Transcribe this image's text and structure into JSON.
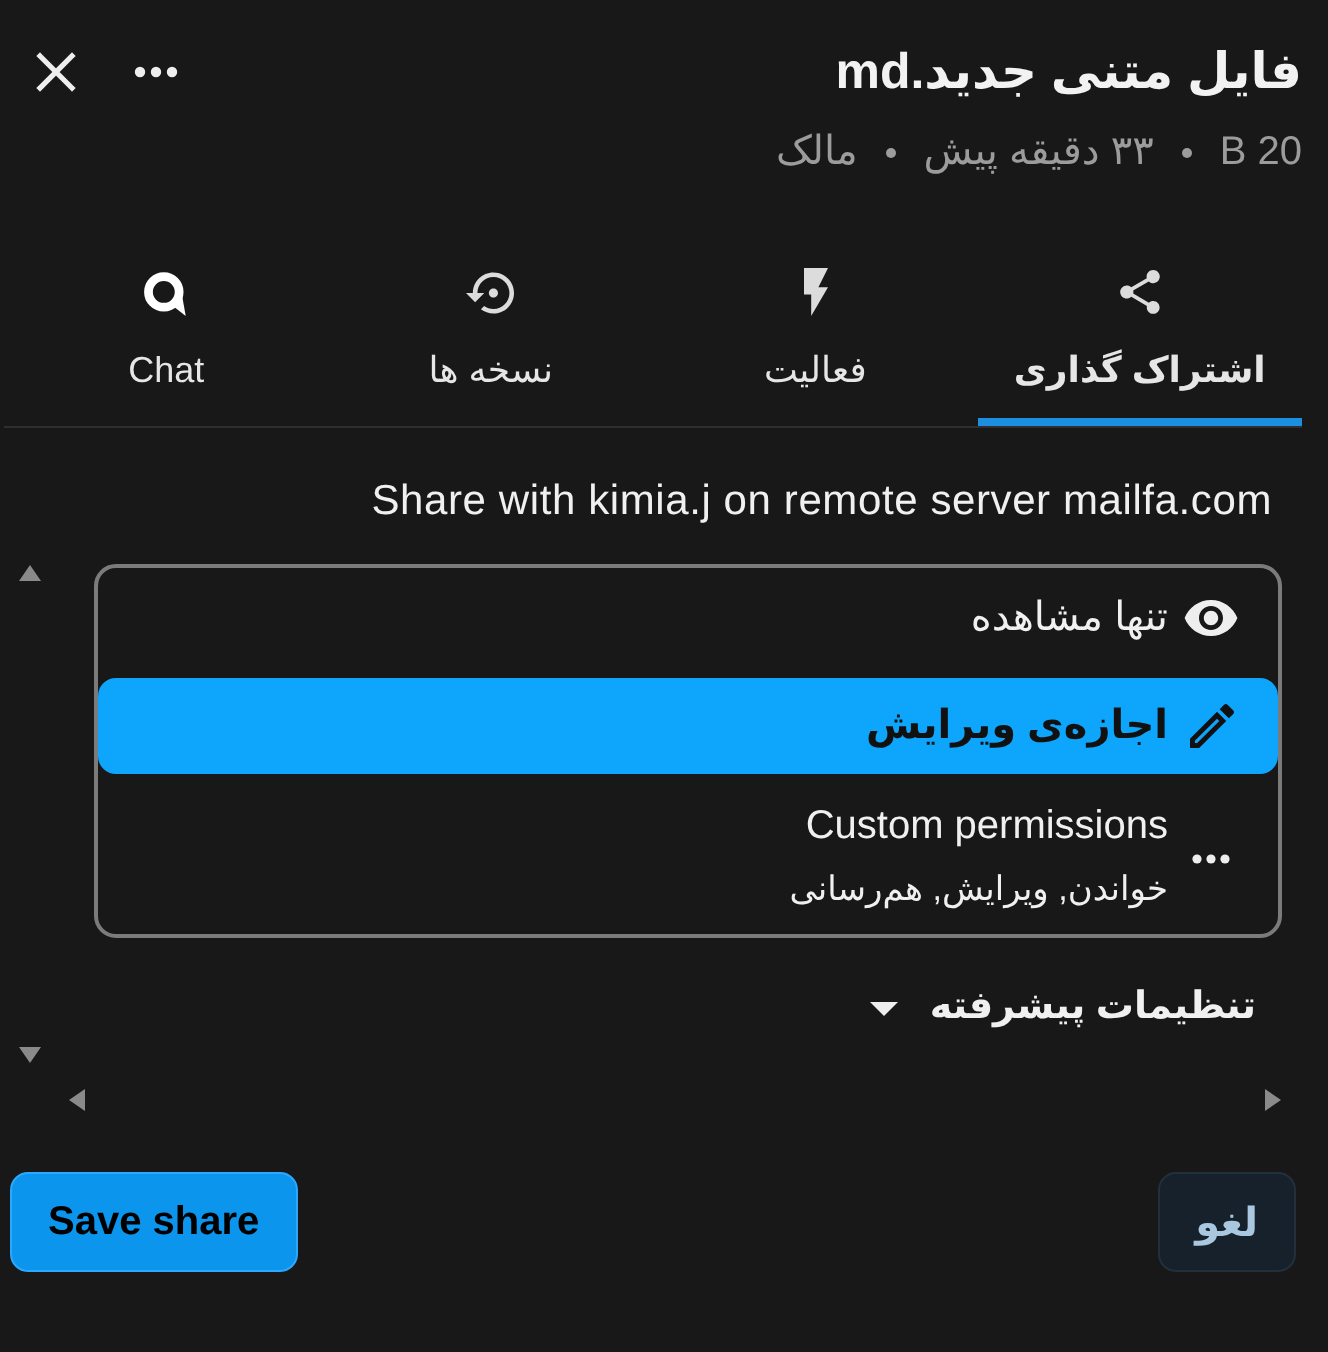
{
  "header": {
    "title": "فایل متنی جدید.md",
    "meta": [
      "20 B",
      "۳۳ دقیقه پیش",
      "مالک"
    ]
  },
  "tabs": [
    {
      "label": "اشتراک گذاری",
      "kind": "share",
      "selected": true
    },
    {
      "label": "فعالیت",
      "kind": "activity",
      "selected": false
    },
    {
      "label": "نسخه ها",
      "kind": "versions",
      "selected": false
    },
    {
      "label": "Chat",
      "kind": "chat",
      "selected": false
    }
  ],
  "share": {
    "recipient_line": "Share with kimia.j on remote server mailfa.com",
    "permissions": [
      {
        "kind": "view",
        "label": "تنها مشاهده",
        "selected": false
      },
      {
        "kind": "edit",
        "label": "اجازه‌ی ویرایش",
        "selected": true
      },
      {
        "kind": "custom",
        "label": "Custom permissions",
        "description": "خواندن, ویرایش, هم‌رسانی",
        "selected": false
      }
    ],
    "advanced": {
      "label": "تنظیمات پیشرفته",
      "expanded": false
    }
  },
  "buttons": [
    {
      "label": "لغو",
      "kind": "cancel"
    },
    {
      "label": "Save share",
      "kind": "primary"
    }
  ]
}
